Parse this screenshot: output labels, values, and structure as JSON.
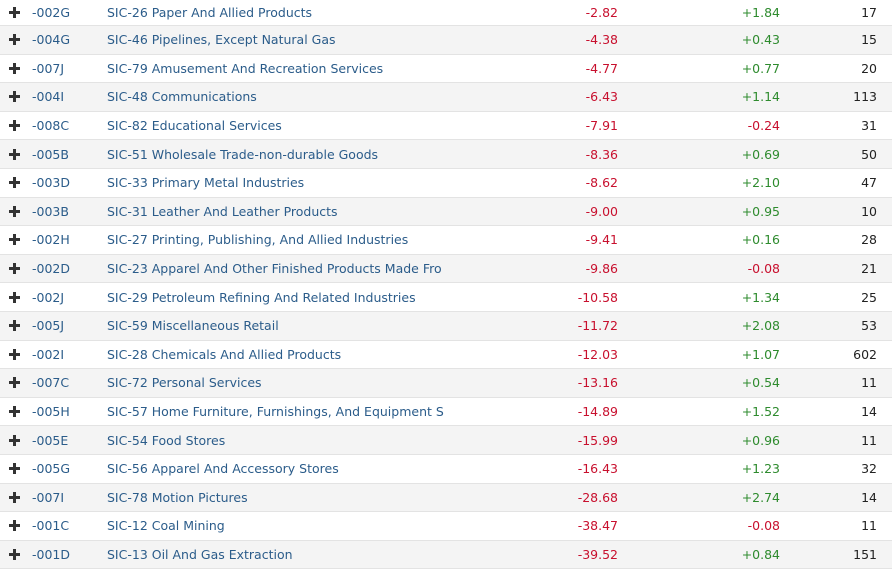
{
  "colors": {
    "link": "#2b5c8a",
    "negative": "#c8102e",
    "positive": "#2e8b2e",
    "text": "#222222"
  },
  "rows": [
    {
      "code": "-002G",
      "name": "SIC-26 Paper And Allied Products",
      "value": "-2.82",
      "change": "+1.84",
      "count": "17"
    },
    {
      "code": "-004G",
      "name": "SIC-46 Pipelines, Except Natural Gas",
      "value": "-4.38",
      "change": "+0.43",
      "count": "15"
    },
    {
      "code": "-007J",
      "name": "SIC-79 Amusement And Recreation Services",
      "value": "-4.77",
      "change": "+0.77",
      "count": "20"
    },
    {
      "code": "-004I",
      "name": "SIC-48 Communications",
      "value": "-6.43",
      "change": "+1.14",
      "count": "113"
    },
    {
      "code": "-008C",
      "name": "SIC-82 Educational Services",
      "value": "-7.91",
      "change": "-0.24",
      "count": "31"
    },
    {
      "code": "-005B",
      "name": "SIC-51 Wholesale Trade-non-durable Goods",
      "value": "-8.36",
      "change": "+0.69",
      "count": "50"
    },
    {
      "code": "-003D",
      "name": "SIC-33 Primary Metal Industries",
      "value": "-8.62",
      "change": "+2.10",
      "count": "47"
    },
    {
      "code": "-003B",
      "name": "SIC-31 Leather And Leather Products",
      "value": "-9.00",
      "change": "+0.95",
      "count": "10"
    },
    {
      "code": "-002H",
      "name": "SIC-27 Printing, Publishing, And Allied Industries",
      "value": "-9.41",
      "change": "+0.16",
      "count": "28"
    },
    {
      "code": "-002D",
      "name": "SIC-23 Apparel And Other Finished Products Made Fro",
      "value": "-9.86",
      "change": "-0.08",
      "count": "21"
    },
    {
      "code": "-002J",
      "name": "SIC-29 Petroleum Refining And Related Industries",
      "value": "-10.58",
      "change": "+1.34",
      "count": "25"
    },
    {
      "code": "-005J",
      "name": "SIC-59 Miscellaneous Retail",
      "value": "-11.72",
      "change": "+2.08",
      "count": "53"
    },
    {
      "code": "-002I",
      "name": "SIC-28 Chemicals And Allied Products",
      "value": "-12.03",
      "change": "+1.07",
      "count": "602"
    },
    {
      "code": "-007C",
      "name": "SIC-72 Personal Services",
      "value": "-13.16",
      "change": "+0.54",
      "count": "11"
    },
    {
      "code": "-005H",
      "name": "SIC-57 Home Furniture, Furnishings, And Equipment S",
      "value": "-14.89",
      "change": "+1.52",
      "count": "14"
    },
    {
      "code": "-005E",
      "name": "SIC-54 Food Stores",
      "value": "-15.99",
      "change": "+0.96",
      "count": "11"
    },
    {
      "code": "-005G",
      "name": "SIC-56 Apparel And Accessory Stores",
      "value": "-16.43",
      "change": "+1.23",
      "count": "32"
    },
    {
      "code": "-007I",
      "name": "SIC-78 Motion Pictures",
      "value": "-28.68",
      "change": "+2.74",
      "count": "14"
    },
    {
      "code": "-001C",
      "name": "SIC-12 Coal Mining",
      "value": "-38.47",
      "change": "-0.08",
      "count": "11"
    },
    {
      "code": "-001D",
      "name": "SIC-13 Oil And Gas Extraction",
      "value": "-39.52",
      "change": "+0.84",
      "count": "151"
    }
  ]
}
